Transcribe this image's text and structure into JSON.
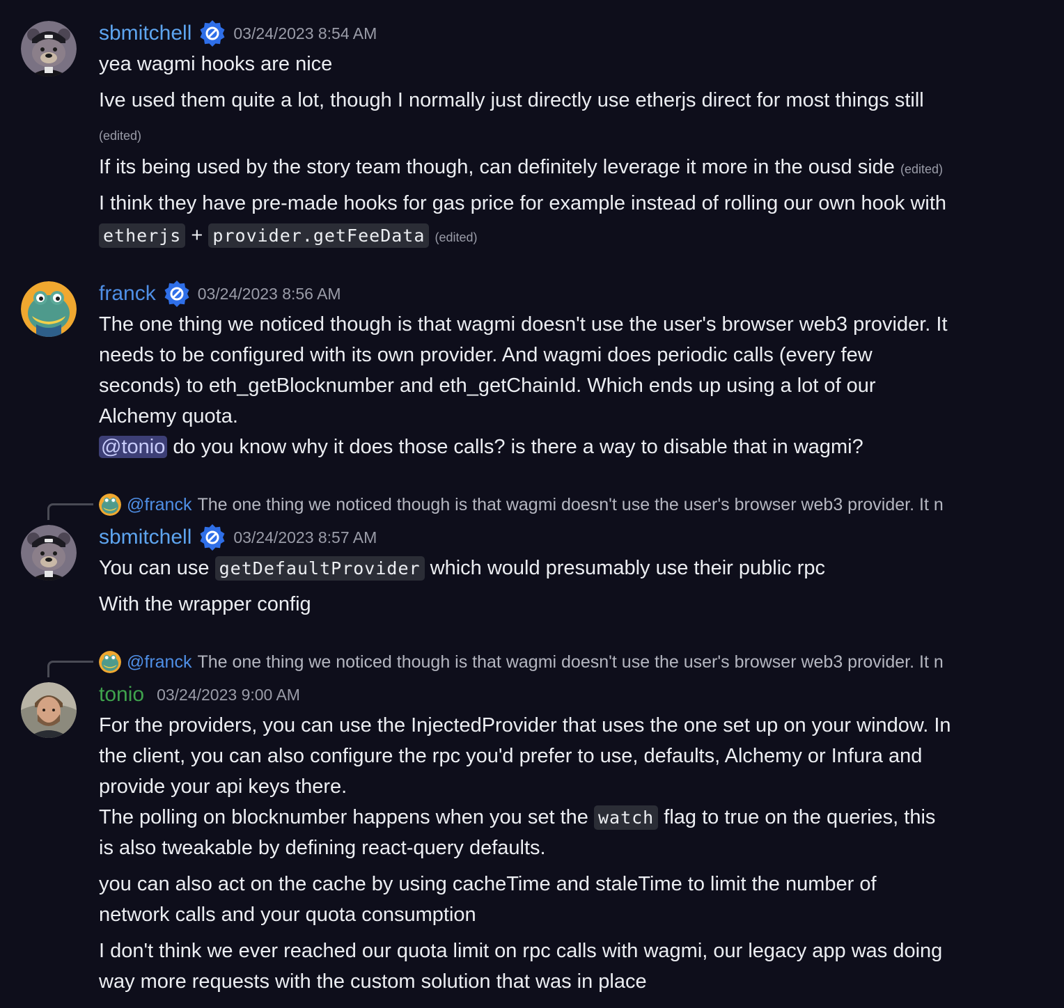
{
  "colors": {
    "background": "#0e0e1b",
    "text": "#eceef2",
    "muted": "#9a9ca8",
    "sbmitchell_name": "#5ea5f0",
    "franck_name": "#4f8fe6",
    "tonio_name": "#3fa34d",
    "badge": "#2f6fe8",
    "mention_bg": "#3d3f76",
    "code_bg": "#2b2d36"
  },
  "messages": [
    {
      "author": "sbmitchell",
      "timestamp": "03/24/2023 8:54 AM",
      "avatar_icon": "bear-avatar",
      "badge_icon": "verified-badge-icon",
      "lines": {
        "l1": "yea wagmi hooks are nice",
        "l2": "Ive used them quite a lot, though I normally just directly use etherjs direct for most things still",
        "l2_edited": "(edited)",
        "l3": "If its being used by the story team though, can definitely leverage it more in the ousd side",
        "l3_edited": "(edited)",
        "l4": "I think they have pre-made hooks for gas price for example instead of rolling our own hook with",
        "l5_code1": "etherjs",
        "l5_plus": "+",
        "l5_code2": "provider.getFeeData",
        "l5_edited": "(edited)"
      }
    },
    {
      "author": "franck",
      "timestamp": "03/24/2023 8:56 AM",
      "avatar_icon": "frog-avatar",
      "badge_icon": "verified-badge-icon",
      "lines": {
        "l1": "The one thing we noticed though is that wagmi doesn't use the user's browser web3 provider. It",
        "l2": "needs to be configured with its own provider. And wagmi does periodic calls (every few",
        "l3": "seconds) to eth_getBlocknumber and eth_getChainId. Which ends up using a lot of our",
        "l4": "Alchemy quota.",
        "l5_mention": "@tonio",
        "l5_text": " do you know why it does those calls? is there a way to disable that in wagmi?"
      }
    },
    {
      "reply_to": {
        "author": "@franck",
        "preview": "The one thing we noticed though is that wagmi doesn't use the user's browser web3 provider. It n"
      },
      "author": "sbmitchell",
      "timestamp": "03/24/2023 8:57 AM",
      "avatar_icon": "bear-avatar",
      "badge_icon": "verified-badge-icon",
      "lines": {
        "l1_pre": "You can use ",
        "l1_code": "getDefaultProvider",
        "l1_post": " which would presumably use their public rpc",
        "l2": "With the wrapper config"
      }
    },
    {
      "reply_to": {
        "author": "@franck",
        "preview": "The one thing we noticed though is that wagmi doesn't use the user's browser web3 provider. It n"
      },
      "author": "tonio",
      "timestamp": "03/24/2023 9:00 AM",
      "avatar_icon": "person-avatar",
      "lines": {
        "l1": "For the providers, you can use the InjectedProvider that uses the one set up on your window. In",
        "l2": "the client, you can also configure the rpc you'd prefer to use, defaults, Alchemy or Infura and",
        "l3": "provide your api keys there.",
        "l4_pre": "The polling on blocknumber happens when you set the ",
        "l4_code": "watch",
        "l4_post": " flag to true on the queries, this",
        "l5": "is also tweakable by defining react-query defaults.",
        "l6": "you can also act on the cache by using cacheTime and staleTime to limit the number of",
        "l7": "network calls and your quota consumption",
        "l8": "I don't think we ever reached our quota limit on rpc calls with wagmi, our legacy app was doing",
        "l9": "way more requests with the custom solution that was in place"
      }
    }
  ]
}
